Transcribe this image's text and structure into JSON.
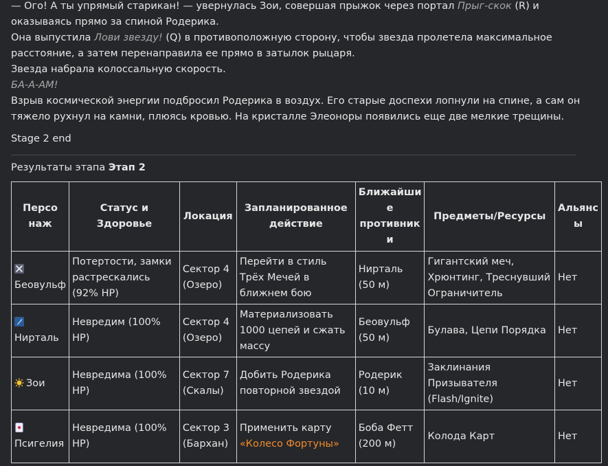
{
  "story": {
    "line1_a": "— Ого! А ты упрямый старикан! — увернулась Зои, совершая прыжок через портал ",
    "line1_skill": "Прыг-скок",
    "line1_b": " (R) и оказываясь прямо за спиной Родерика.",
    "line2_a": "Она выпустила ",
    "line2_skill": "Лови звезду!",
    "line2_b": " (Q) в противоположную сторону, чтобы звезда пролетела максимальное расстояние, а затем перенаправила ее прямо в затылок рыцаря.",
    "line3": "Звезда набрала колоссальную скорость.",
    "line4": "БА-А-АМ!",
    "line5": "Взрыв космической энергии подбросил Родерика в воздух. Его старые доспехи лопнули на спине, а сам он тяжело рухнул на камни, плюясь кровью. На кристалле Элеоноры появились еще две мелкие трещины.",
    "stage_end": "Stage 2 end"
  },
  "results": {
    "title_prefix": "Результаты этапа ",
    "title_bold": "Этап 2",
    "headers": {
      "character": "Персо наж",
      "status": "Статус и Здоровье",
      "location": "Локация",
      "planned": "Запланированное действие",
      "nearest": "Ближайши е противник и",
      "items": "Предметы/Ресурсы",
      "alliances": "Альянс ы"
    },
    "rows": [
      {
        "icon": "crossed-swords-icon",
        "name": "Беовульф",
        "status": "Потертости, замки растрескались (92% HP)",
        "location": "Сектор 4 (Озеро)",
        "planned": "Перейти в стиль Трёх Мечей в ближнем бою",
        "nearest": "Нирталь (50 м)",
        "items": "Гигантский меч, Хрюнтинг, Треснувший Ограничитель",
        "alliances": "Нет"
      },
      {
        "icon": "feather-pen-icon",
        "name": "Нирталь",
        "status": "Невредим (100% HP)",
        "location": "Сектор 4 (Озеро)",
        "planned": "Материализовать 1000 цепей и сжать массу",
        "nearest": "Беовульф (50 м)",
        "items": "Булава, Цепи Порядка",
        "alliances": "Нет"
      },
      {
        "icon": "sun-icon",
        "name": "Зои",
        "status": "Невредима (100% HP)",
        "location": "Сектор 7 (Скалы)",
        "planned": "Добить Родерика повторной звездой",
        "nearest": "Родерик (10 м)",
        "items": "Заклинания Призывателя (Flash/Ignite)",
        "alliances": "Нет"
      },
      {
        "icon": "playing-card-icon",
        "name": "Псигелия",
        "status": "Невредима (100% HP)",
        "location": "Сектор 3 (Бархан)",
        "planned_a": "Применить карту ",
        "planned_accent": "«Колесо Фортуны»",
        "nearest": "Боба Фетт (200 м)",
        "items": "Колода Карт",
        "alliances": "Нет"
      }
    ]
  },
  "colors": {
    "background": "#26272b",
    "text": "#e6e6e6",
    "muted_italic": "#a8a8a8",
    "accent": "#f08c2a",
    "table_border": "#d6d6d6"
  }
}
